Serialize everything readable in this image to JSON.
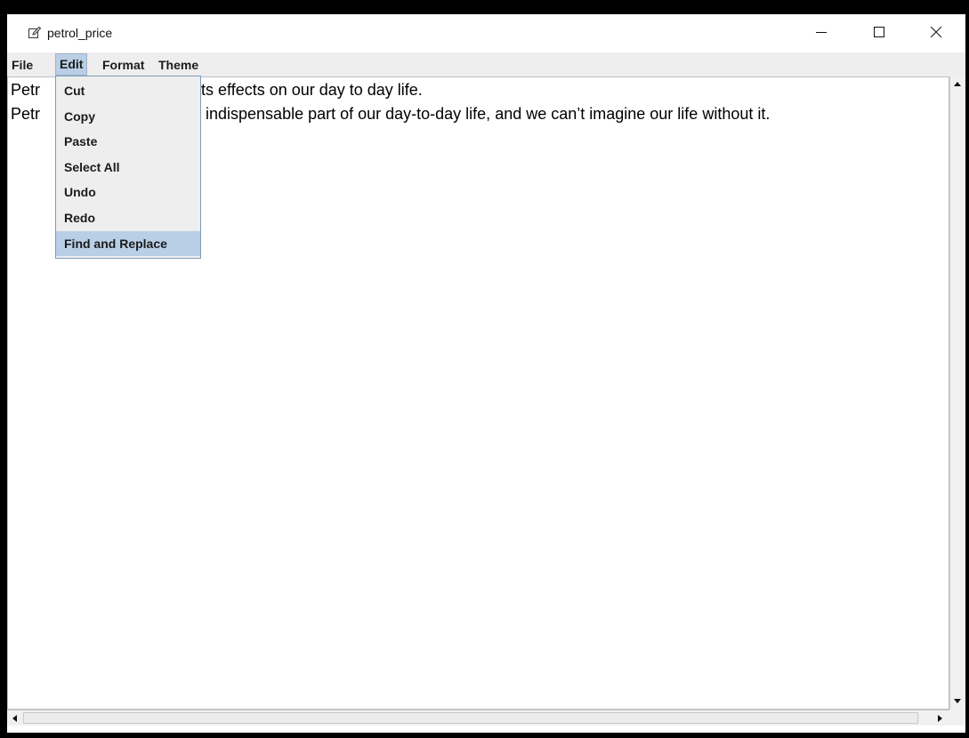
{
  "window": {
    "title": "petrol_price",
    "title_icon": "edit-icon",
    "controls": [
      "minimize-icon",
      "maximize-icon",
      "close-icon"
    ]
  },
  "menubar": {
    "items": [
      {
        "label": "File"
      },
      {
        "label": "Edit",
        "active": true
      },
      {
        "label": "Format"
      },
      {
        "label": "Theme"
      }
    ]
  },
  "edit_menu": {
    "items": [
      {
        "label": "Cut"
      },
      {
        "label": "Copy"
      },
      {
        "label": "Paste"
      },
      {
        "label": "Select All"
      },
      {
        "label": "Undo"
      },
      {
        "label": "Redo"
      },
      {
        "label": "Find and Replace",
        "highlighted": true
      }
    ]
  },
  "editor": {
    "lines": [
      {
        "visible_start": "Petr",
        "visible_end": "ts effects on our day to day life."
      },
      {
        "visible_start": "Petr",
        "visible_end": " indispensable part of our day-to-day life, and we can’t imagine our life without it."
      }
    ]
  },
  "colors": {
    "menubar_bg": "#eeeeee",
    "highlight": "#b8cfe5",
    "menu_border": "#7f9db9"
  }
}
